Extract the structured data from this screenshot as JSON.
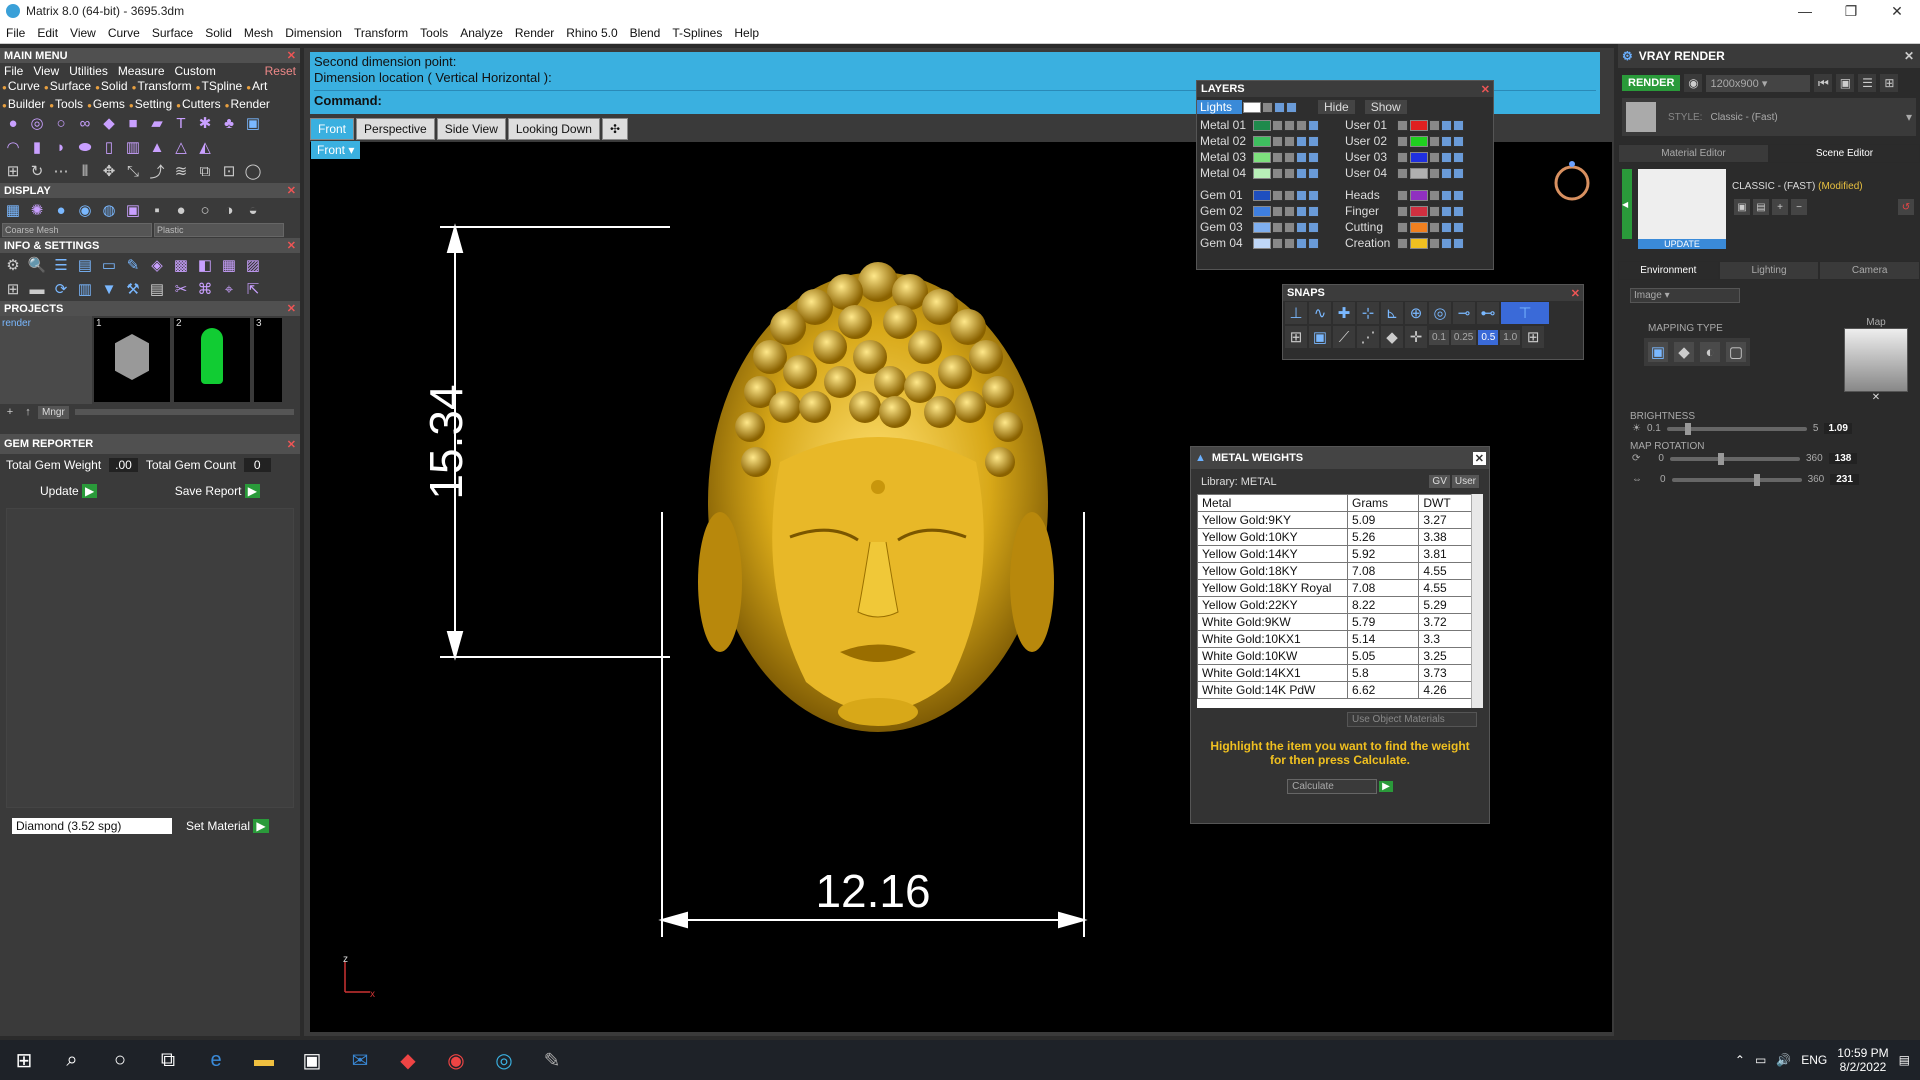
{
  "window": {
    "title": "Matrix 8.0 (64-bit) - 3695.3dm",
    "min": "—",
    "max": "❐",
    "close": "✕"
  },
  "menubar": [
    "File",
    "Edit",
    "View",
    "Curve",
    "Surface",
    "Solid",
    "Mesh",
    "Dimension",
    "Transform",
    "Tools",
    "Analyze",
    "Render",
    "Rhino 5.0",
    "Blend",
    "T-Splines",
    "Help"
  ],
  "main_menu": {
    "title": "MAIN MENU",
    "reset": "Reset",
    "menu": [
      "File",
      "View",
      "Utilities",
      "Measure",
      "Custom"
    ],
    "tabs": [
      "Curve",
      "Surface",
      "Solid",
      "Transform",
      "TSpline",
      "Art",
      "Builder",
      "Tools",
      "Gems",
      "Setting",
      "Cutters",
      "Render"
    ]
  },
  "display": {
    "title": "DISPLAY",
    "mesh": "Coarse Mesh",
    "material": "Plastic"
  },
  "info": {
    "title": "INFO & SETTINGS"
  },
  "projects": {
    "title": "PROJECTS",
    "item": "render",
    "thumbs": [
      "1",
      "2",
      "3"
    ],
    "mngr": "Mngr"
  },
  "gem_reporter": {
    "title": "GEM REPORTER",
    "weight_label": "Total Gem Weight",
    "weight_value": ".00",
    "count_label": "Total Gem Count",
    "count_value": "0",
    "update": "Update",
    "save": "Save Report",
    "material": "Diamond   (3.52 spg)",
    "set_material": "Set Material"
  },
  "command": {
    "line1": "Second dimension point:",
    "line2": "Dimension location ( Vertical  Horizontal ):",
    "prompt": "Command:"
  },
  "view_tabs": [
    "Front",
    "Perspective",
    "Side View",
    "Looking Down",
    "✣"
  ],
  "viewport": {
    "label": "Front",
    "dim_vertical": "15.34",
    "dim_horizontal": "12.16",
    "axis_z": "z",
    "axis_x": "x"
  },
  "layers": {
    "title": "LAYERS",
    "lights": "Lights",
    "hide": "Hide",
    "show": "Show",
    "left": [
      {
        "name": "Metal 01",
        "color": "#1f8a4c"
      },
      {
        "name": "Metal 02",
        "color": "#3fbf5f"
      },
      {
        "name": "Metal 03",
        "color": "#7ee07e"
      },
      {
        "name": "Metal 04",
        "color": "#b8f0b8"
      },
      {
        "name": "Gem 01",
        "color": "#1f4fbf"
      },
      {
        "name": "Gem 02",
        "color": "#3f7fdf"
      },
      {
        "name": "Gem 03",
        "color": "#7fafef"
      },
      {
        "name": "Gem 04",
        "color": "#bfd7f7"
      }
    ],
    "right": [
      {
        "name": "User 01",
        "color": "#e02020"
      },
      {
        "name": "User 02",
        "color": "#20d020"
      },
      {
        "name": "User 03",
        "color": "#2030e0"
      },
      {
        "name": "User 04",
        "color": "#b0b0b0"
      },
      {
        "name": "Heads",
        "color": "#9030c0"
      },
      {
        "name": "Finger",
        "color": "#d03040"
      },
      {
        "name": "Cutting",
        "color": "#f08020"
      },
      {
        "name": "Creation",
        "color": "#f0c020"
      }
    ]
  },
  "snaps": {
    "title": "SNAPS",
    "values": [
      "0.1",
      "0.25",
      "0.5",
      "1.0"
    ]
  },
  "metal_weights": {
    "title": "METAL WEIGHTS",
    "library": "Library: METAL",
    "gv": "GV",
    "user": "User",
    "headers": [
      "Metal",
      "Grams",
      "DWT"
    ],
    "rows": [
      [
        "Yellow Gold:9KY",
        "5.09",
        "3.27"
      ],
      [
        "Yellow Gold:10KY",
        "5.26",
        "3.38"
      ],
      [
        "Yellow Gold:14KY",
        "5.92",
        "3.81"
      ],
      [
        "Yellow Gold:18KY",
        "7.08",
        "4.55"
      ],
      [
        "Yellow Gold:18KY Royal",
        "7.08",
        "4.55"
      ],
      [
        "Yellow Gold:22KY",
        "8.22",
        "5.29"
      ],
      [
        "White Gold:9KW",
        "5.79",
        "3.72"
      ],
      [
        "White Gold:10KX1",
        "5.14",
        "3.3"
      ],
      [
        "White Gold:10KW",
        "5.05",
        "3.25"
      ],
      [
        "White Gold:14KX1",
        "5.8",
        "3.73"
      ],
      [
        "White Gold:14K PdW",
        "6.62",
        "4.26"
      ]
    ],
    "use_obj": "Use Object Materials",
    "hint": "Highlight the item you want to find the weight for then press Calculate.",
    "calc": "Calculate"
  },
  "vray": {
    "title": "VRAY RENDER",
    "render": "RENDER",
    "resolution": "1200x900",
    "style_label": "STYLE:",
    "style": "Classic - (Fast)",
    "tabs_top": [
      "Material Editor",
      "Scene Editor"
    ],
    "preset": "CLASSIC - (FAST)",
    "modified": "(Modified)",
    "update": "UPDATE",
    "tabs_env": [
      "Environment",
      "Lighting",
      "Camera"
    ],
    "image": "Image",
    "map": "Map",
    "mapping_type": "MAPPING TYPE",
    "brightness": "BRIGHTNESS",
    "b_min": "0.1",
    "b_max": "5",
    "b_val": "1.09",
    "map_rotation": "MAP ROTATION",
    "r1_min": "0",
    "r1_max": "360",
    "r1_val": "138",
    "r2_min": "0",
    "r2_max": "360",
    "r2_val": "231"
  },
  "taskbar": {
    "lang": "ENG",
    "time": "10:59 PM",
    "date": "8/2/2022"
  }
}
